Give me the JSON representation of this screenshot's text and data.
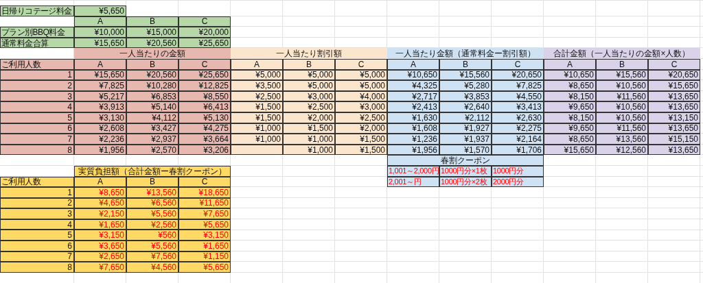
{
  "cottage": {
    "label": "日帰りコテージ料金",
    "value": "¥5,650",
    "color": "#b6d7a8"
  },
  "plans": {
    "color": "#b6d7a8",
    "columns": [
      "A",
      "B",
      "C"
    ],
    "rows": [
      {
        "label": "プラン別BBQ料金",
        "values": [
          "¥10,000",
          "¥15,000",
          "¥20,000"
        ]
      },
      {
        "label": "通常料金合算",
        "values": [
          "¥15,650",
          "¥20,560",
          "¥25,650"
        ]
      }
    ]
  },
  "main_table": {
    "row_header": "ご利用人数",
    "people": [
      "1",
      "2",
      "3",
      "4",
      "5",
      "6",
      "7",
      "8"
    ],
    "sections": [
      {
        "title": "一人当たりの金額",
        "color": "#e6b8af",
        "columns": [
          "A",
          "B",
          "C"
        ],
        "rows": [
          [
            "¥15,650",
            "¥20,560",
            "¥25,650"
          ],
          [
            "¥7,825",
            "¥10,280",
            "¥12,825"
          ],
          [
            "¥5,217",
            "¥6,853",
            "¥8,550"
          ],
          [
            "¥3,913",
            "¥5,140",
            "¥6,413"
          ],
          [
            "¥3,130",
            "¥4,112",
            "¥5,130"
          ],
          [
            "¥2,608",
            "¥3,427",
            "¥4,275"
          ],
          [
            "¥2,236",
            "¥2,937",
            "¥3,664"
          ],
          [
            "¥1,956",
            "¥2,570",
            "¥3,206"
          ]
        ]
      },
      {
        "title": "一人当たり割引額",
        "color": "#fce5cd",
        "columns": [
          "A",
          "B",
          "C"
        ],
        "rows": [
          [
            "¥5,000",
            "¥5,000",
            "¥5,000"
          ],
          [
            "¥3,500",
            "¥5,000",
            "¥5,000"
          ],
          [
            "¥2,500",
            "¥3,000",
            "¥4,000"
          ],
          [
            "¥1,500",
            "¥2,500",
            "¥3,000"
          ],
          [
            "¥1,500",
            "¥2,000",
            "¥2,500"
          ],
          [
            "¥1,000",
            "¥1,500",
            "¥2,000"
          ],
          [
            "¥1,000",
            "¥1,000",
            "¥1,500"
          ],
          [
            null,
            "¥1,000",
            "¥1,500"
          ]
        ]
      },
      {
        "title": "一人当たり金額（通常料金ー割引額）",
        "color": "#cfe2f3",
        "columns": [
          "A",
          "B",
          "C"
        ],
        "rows": [
          [
            "¥10,650",
            "¥15,560",
            "¥20,650"
          ],
          [
            "¥4,325",
            "¥5,280",
            "¥7,825"
          ],
          [
            "¥2,717",
            "¥3,853",
            "¥4,550"
          ],
          [
            "¥2,413",
            "¥2,640",
            "¥3,413"
          ],
          [
            "¥1,630",
            "¥2,112",
            "¥2,630"
          ],
          [
            "¥1,608",
            "¥1,927",
            "¥2,275"
          ],
          [
            "¥1,236",
            "¥1,937",
            "¥2,164"
          ],
          [
            "¥1,956",
            "¥1,570",
            "¥1,706"
          ]
        ]
      },
      {
        "title": "合計金額（一人当たりの金額×人数）",
        "color": "#d9d2e9",
        "columns": [
          "A",
          "B",
          "C"
        ],
        "rows": [
          [
            "¥10,650",
            "¥15,560",
            "¥20,650"
          ],
          [
            "¥8,650",
            "¥10,560",
            "¥15,650"
          ],
          [
            "¥8,150",
            "¥11,560",
            "¥13,650"
          ],
          [
            "¥9,650",
            "¥10,560",
            "¥13,650"
          ],
          [
            "¥8,150",
            "¥10,560",
            "¥13,150"
          ],
          [
            "¥9,650",
            "¥11,560",
            "¥13,650"
          ],
          [
            "¥8,650",
            "¥13,560",
            "¥15,150"
          ],
          [
            "¥15,650",
            "¥12,560",
            "¥13,650"
          ]
        ]
      }
    ]
  },
  "coupon": {
    "title": "春割クーポン",
    "color": "#cfe2f3",
    "rows": [
      [
        "1,001～2,000円",
        "1000円分×1枚",
        "1000円分"
      ],
      [
        "2,001～円",
        "1000円分×2枚",
        "2000円分"
      ]
    ]
  },
  "burden": {
    "title": "実質負担額（合計金額ー春割クーポン）",
    "color": "#ffd966",
    "row_header": "ご利用人数",
    "columns": [
      "A",
      "B",
      "C"
    ],
    "people": [
      "1",
      "2",
      "3",
      "4",
      "5",
      "6",
      "7",
      "8"
    ],
    "rows": [
      [
        "¥8,650",
        "¥13,560",
        "¥18,650"
      ],
      [
        "¥4,650",
        "¥6,560",
        "¥11,650"
      ],
      [
        "¥2,150",
        "¥5,560",
        "¥7,650"
      ],
      [
        "¥1,650",
        "¥2,560",
        "¥5,650"
      ],
      [
        "¥3,150",
        "¥560",
        "¥3,150"
      ],
      [
        "¥3,650",
        "¥5,560",
        "¥1,650"
      ],
      [
        "¥2,650",
        "¥7,560",
        "¥1,150"
      ],
      [
        "¥7,650",
        "¥4,560",
        "¥5,650"
      ]
    ]
  }
}
